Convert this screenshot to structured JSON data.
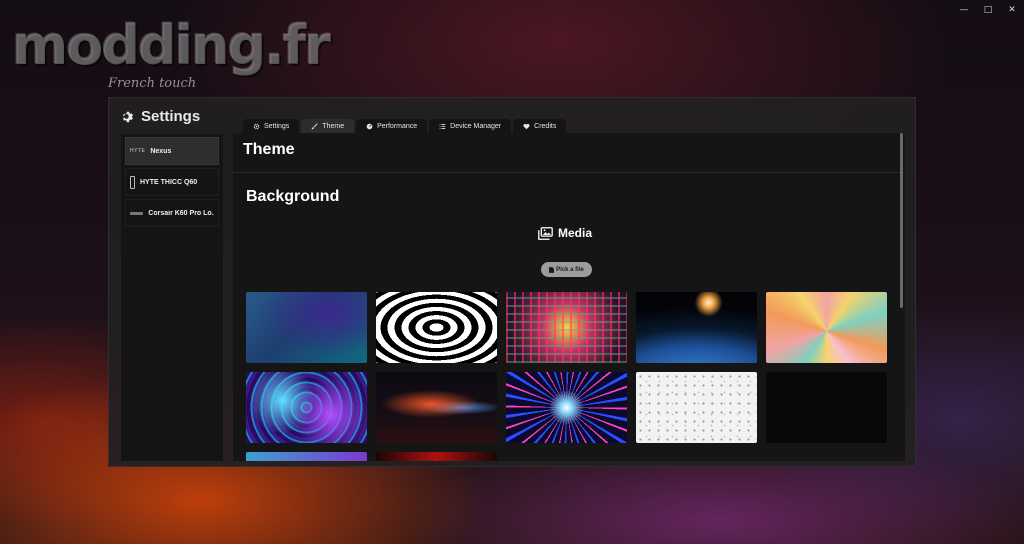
{
  "watermark": {
    "text": "modding.fr",
    "subtitle": "French touch"
  },
  "window_controls": {
    "minimize": "—",
    "maximize": "□",
    "close": "✕"
  },
  "app": {
    "title": "Settings",
    "title_icon": "gear-icon"
  },
  "sidebar": {
    "devices": [
      {
        "label": "Nexus",
        "logo": "HYTE",
        "icon": "hyte-logo",
        "active": true
      },
      {
        "label": "HYTE THICC Q60",
        "icon": "case-icon",
        "active": false
      },
      {
        "label": "Corsair K60 Pro Lo...",
        "icon": "keyboard-icon",
        "active": false
      }
    ]
  },
  "tabs": [
    {
      "label": "Settings",
      "icon": "gear-icon",
      "active": false
    },
    {
      "label": "Theme",
      "icon": "brush-icon",
      "active": true
    },
    {
      "label": "Performance",
      "icon": "gauge-icon",
      "active": false
    },
    {
      "label": "Device Manager",
      "icon": "list-icon",
      "active": false
    },
    {
      "label": "Credits",
      "icon": "heart-icon",
      "active": false
    }
  ],
  "content": {
    "heading": "Theme",
    "section": "Background",
    "media_label": "Media",
    "media_icon": "images-icon",
    "pick_button": "Pick a file",
    "pick_icon": "file-icon"
  },
  "thumbnails": [
    {
      "name": "blue-abstract-wave"
    },
    {
      "name": "black-white-rings"
    },
    {
      "name": "neon-tunnel"
    },
    {
      "name": "earth-from-space"
    },
    {
      "name": "retro-sunburst"
    },
    {
      "name": "psychedelic-swirl"
    },
    {
      "name": "neon-light-streak"
    },
    {
      "name": "hyperspace-warp"
    },
    {
      "name": "white-particles"
    },
    {
      "name": "black-empty"
    },
    {
      "name": "blue-purple-partial"
    },
    {
      "name": "red-partial"
    }
  ]
}
